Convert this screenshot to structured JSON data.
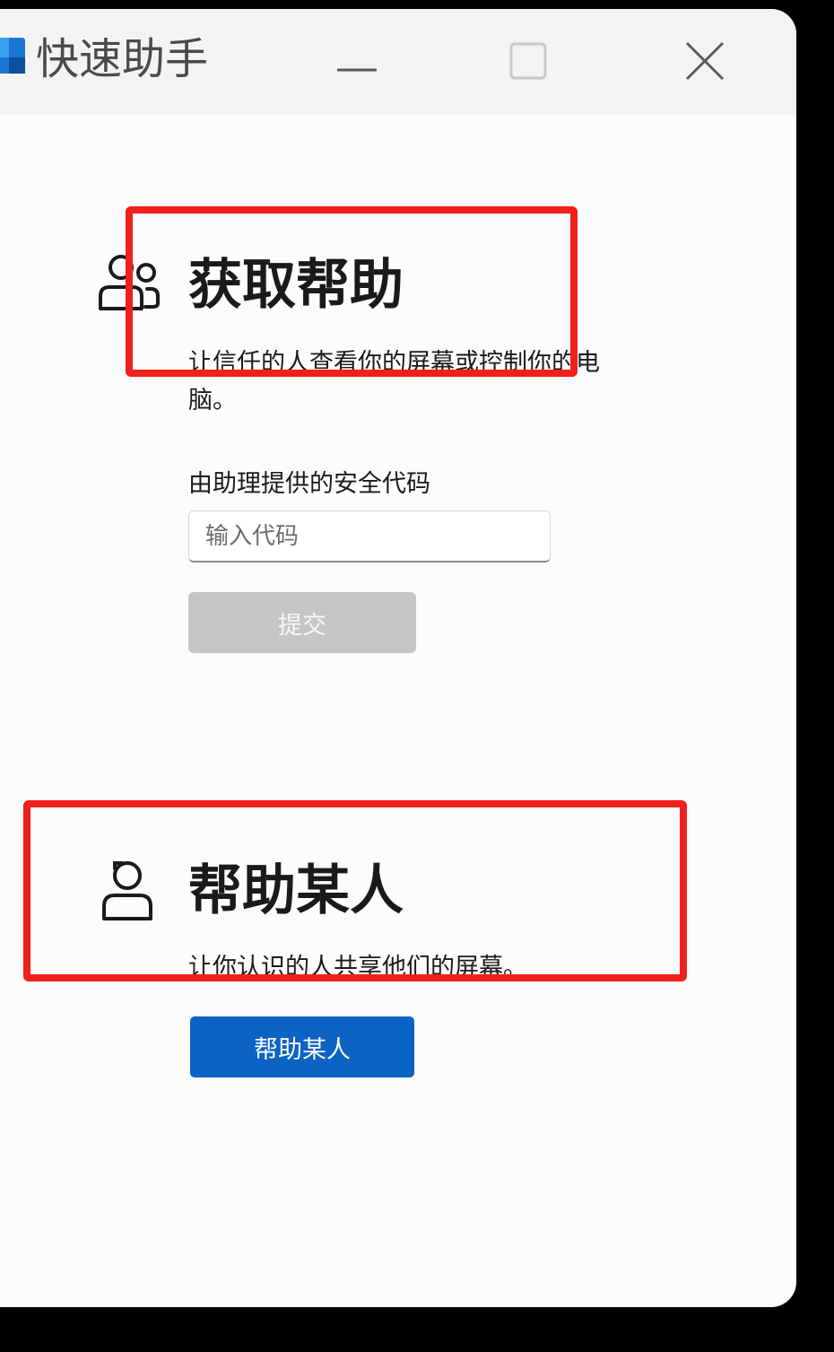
{
  "window": {
    "title": "快速助手",
    "accent_color": "#0b63c4",
    "controls": {
      "minimize_icon": "minimize-icon",
      "maximize_icon": "maximize-icon",
      "close_icon": "close-icon"
    }
  },
  "get_help": {
    "title": "获取帮助",
    "description": "让信任的人查看你的屏幕或控制你的电脑。",
    "code_label": "由助理提供的安全代码",
    "code_value": "",
    "code_placeholder": "输入代码",
    "submit_label": "提交",
    "icon": "people-icon"
  },
  "help_someone": {
    "title": "帮助某人",
    "description": "让你认识的人共享他们的屏幕。",
    "button_label": "帮助某人",
    "icon": "person-icon"
  },
  "annotation": {
    "highlight_color": "#f0201a"
  }
}
